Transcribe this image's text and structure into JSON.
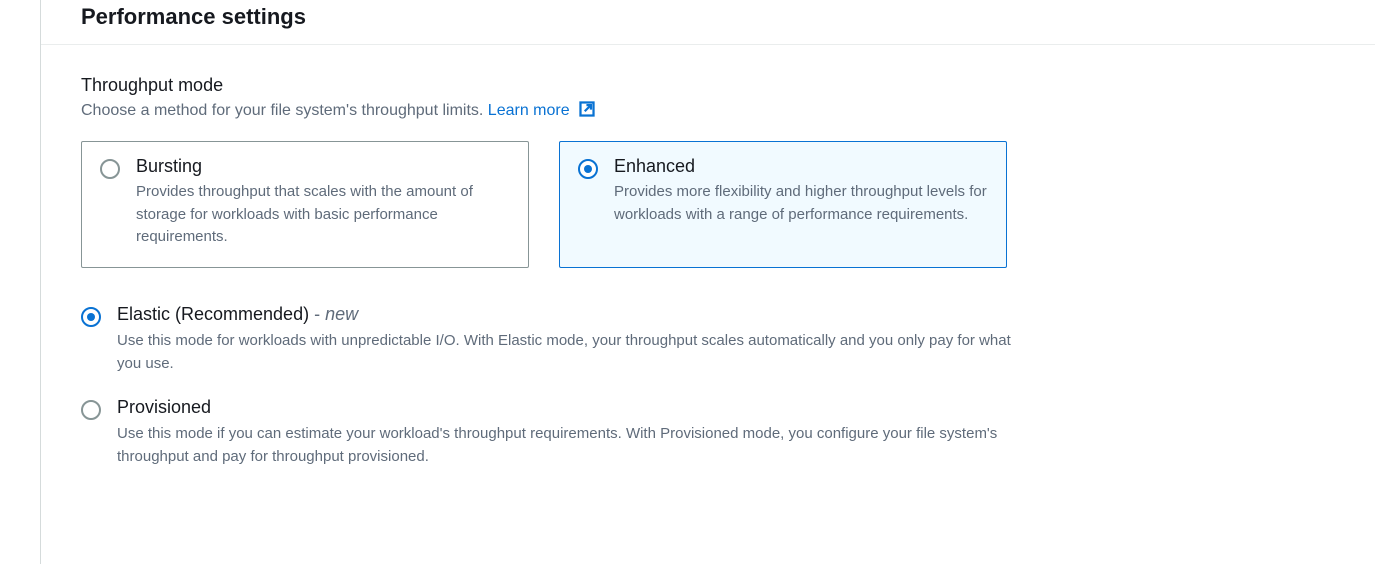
{
  "section": {
    "title": "Performance settings"
  },
  "throughput": {
    "heading": "Throughput mode",
    "help": "Choose a method for your file system's throughput limits. ",
    "learn_more": "Learn more",
    "tiles": {
      "bursting": {
        "title": "Bursting",
        "desc": "Provides throughput that scales with the amount of storage for workloads with basic performance requirements."
      },
      "enhanced": {
        "title": "Enhanced",
        "desc": "Provides more flexibility and higher throughput levels for workloads with a range of performance requirements."
      }
    },
    "sub": {
      "elastic": {
        "title": "Elastic (Recommended)",
        "suffix": " - ",
        "tag": "new",
        "desc": "Use this mode for workloads with unpredictable I/O. With Elastic mode, your throughput scales automatically and you only pay for what you use."
      },
      "provisioned": {
        "title": "Provisioned",
        "desc": "Use this mode if you can estimate your workload's throughput requirements. With Provisioned mode, you configure your file system's throughput and pay for throughput provisioned."
      }
    }
  },
  "state": {
    "mode": "enhanced",
    "sub_mode": "elastic"
  },
  "colors": {
    "link": "#0972d3",
    "selected_bg": "#f1faff",
    "border": "#879596",
    "muted": "#5f6b7a"
  }
}
